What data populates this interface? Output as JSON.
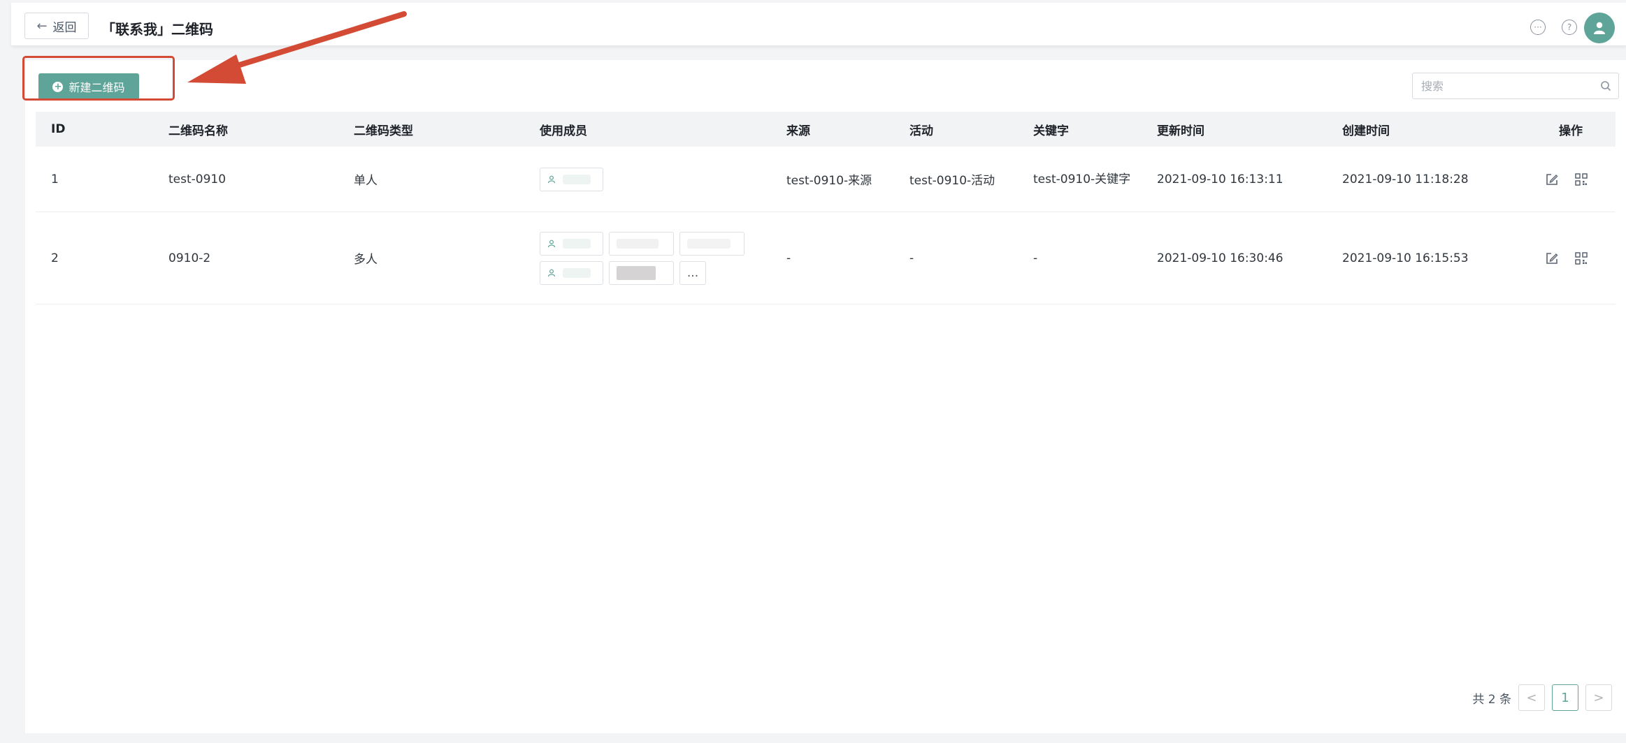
{
  "header": {
    "back_label": "返回",
    "title": "「联系我」二维码"
  },
  "toolbar": {
    "new_button_label": "新建二维码",
    "search_placeholder": "搜索"
  },
  "table": {
    "columns": [
      "ID",
      "二维码名称",
      "二维码类型",
      "使用成员",
      "来源",
      "活动",
      "关键字",
      "更新时间",
      "创建时间",
      "操作"
    ],
    "rows": [
      {
        "id": "1",
        "name": "test-0910",
        "type": "单人",
        "source": "test-0910-来源",
        "activity": "test-0910-活动",
        "keyword": "test-0910-关键字",
        "updated": "2021-09-10 16:13:11",
        "created": "2021-09-10 11:18:28"
      },
      {
        "id": "2",
        "name": "0910-2",
        "type": "多人",
        "source": "-",
        "activity": "-",
        "keyword": "-",
        "updated": "2021-09-10 16:30:46",
        "created": "2021-09-10 16:15:53",
        "more_label": "..."
      }
    ]
  },
  "pagination": {
    "total_label": "共 2 条",
    "current_page": "1",
    "prev": "<",
    "next": ">"
  },
  "colors": {
    "accent": "#5ea498",
    "annotation": "#d34b34"
  }
}
